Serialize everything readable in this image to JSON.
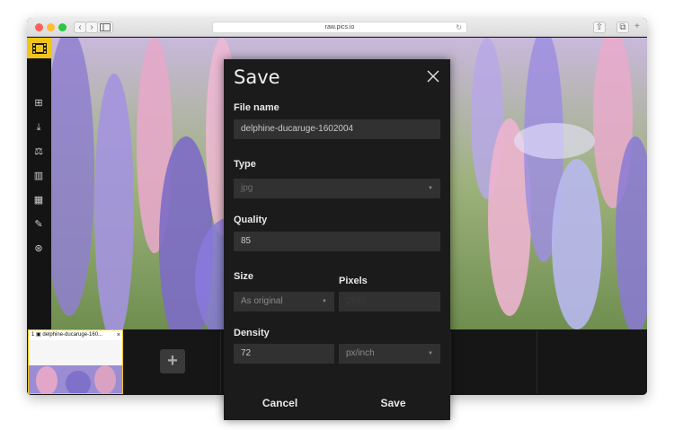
{
  "browser": {
    "url": "raw.pics.io",
    "back_glyph": "‹",
    "forward_glyph": "›",
    "reload_glyph": "↻",
    "share_glyph": "⇧",
    "tabs_glyph": "⧉",
    "newtab_glyph": "+"
  },
  "colors": {
    "accent": "#f0c419",
    "modal_bg": "#1b1b1b",
    "field_bg": "#313131"
  },
  "sidebar": {
    "icons": [
      "film-icon",
      "add-image-icon",
      "download-icon",
      "adjust-icon",
      "compare-icon",
      "grid-icon",
      "pencil-icon",
      "share-icon"
    ],
    "glyphs": {
      "add": "⊞",
      "download": "⤓",
      "adjust": "⚖",
      "compare": "▥",
      "grid": "▦",
      "pencil": "✎",
      "share": "⊛"
    }
  },
  "filmstrip": {
    "thumb_label": "1 ▣ delphine-ducaruge-160...",
    "thumb_close": "×",
    "add_glyph": "+"
  },
  "dialog": {
    "title": "Save",
    "file_name_label": "File name",
    "file_name_value": "delphine-ducaruge-1602004",
    "type_label": "Type",
    "type_value": "jpg",
    "quality_label": "Quality",
    "quality_value": "85",
    "size_label": "Size",
    "size_value": "As original",
    "pixels_label": "Pixels",
    "pixels_value": "2560",
    "density_label": "Density",
    "density_value": "72",
    "density_unit": "px/inch",
    "select_arrow": "▼",
    "cancel_label": "Cancel",
    "save_label": "Save"
  }
}
